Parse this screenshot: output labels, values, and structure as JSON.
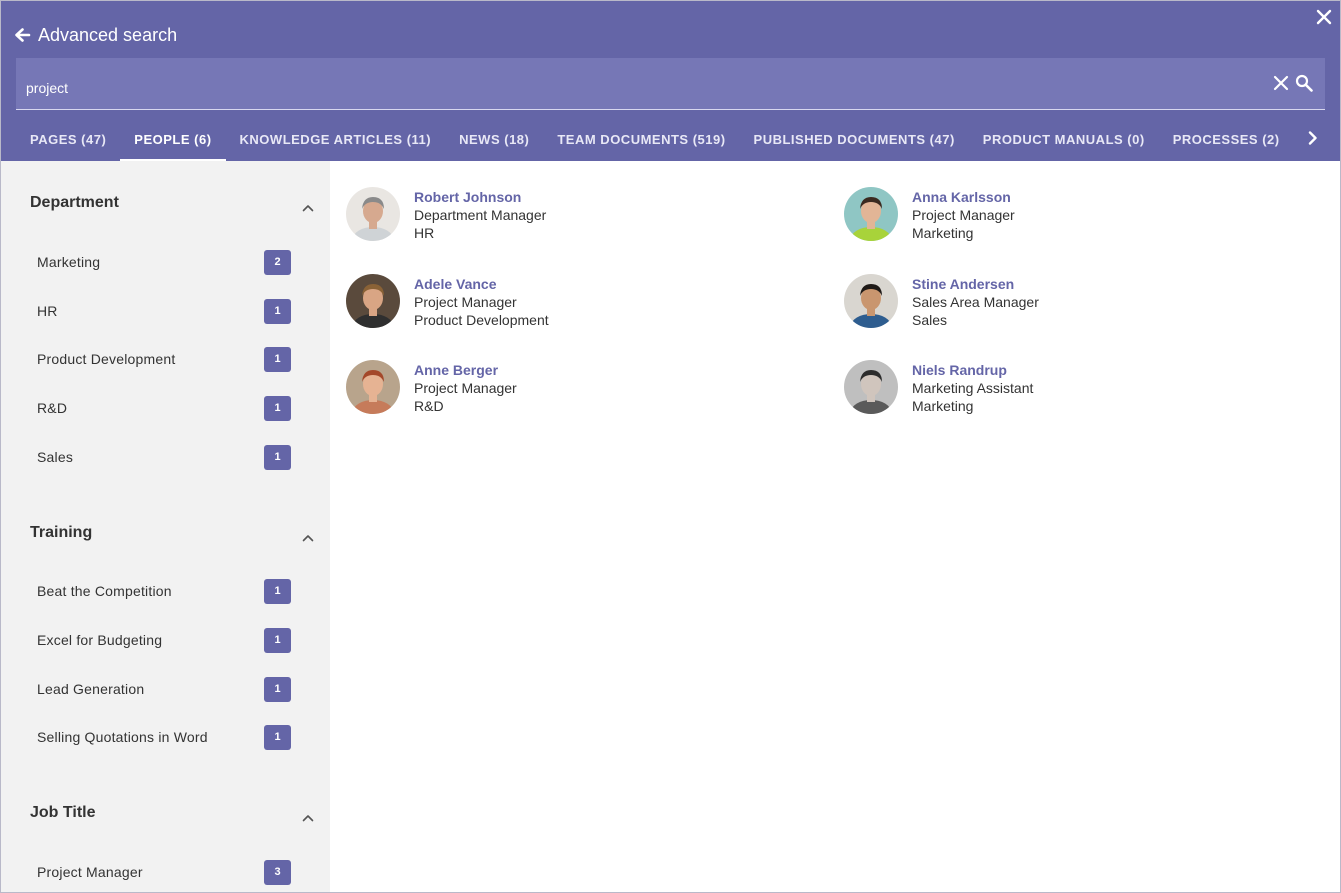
{
  "header": {
    "title": "Advanced search",
    "accent_color": "#6465a7"
  },
  "search": {
    "value": "project",
    "placeholder": ""
  },
  "tabs": [
    {
      "label": "PAGES (47)",
      "active": false
    },
    {
      "label": "PEOPLE (6)",
      "active": true
    },
    {
      "label": "KNOWLEDGE ARTICLES (11)",
      "active": false
    },
    {
      "label": "NEWS (18)",
      "active": false
    },
    {
      "label": "TEAM DOCUMENTS (519)",
      "active": false
    },
    {
      "label": "PUBLISHED DOCUMENTS (47)",
      "active": false
    },
    {
      "label": "PRODUCT MANUALS (0)",
      "active": false
    },
    {
      "label": "PROCESSES (2)",
      "active": false
    }
  ],
  "facets": [
    {
      "title": "Department",
      "items": [
        {
          "label": "Marketing",
          "count": "2"
        },
        {
          "label": "HR",
          "count": "1"
        },
        {
          "label": "Product Development",
          "count": "1"
        },
        {
          "label": "R&D",
          "count": "1"
        },
        {
          "label": "Sales",
          "count": "1"
        }
      ]
    },
    {
      "title": "Training",
      "items": [
        {
          "label": "Beat the Competition",
          "count": "1"
        },
        {
          "label": "Excel for Budgeting",
          "count": "1"
        },
        {
          "label": "Lead Generation",
          "count": "1"
        },
        {
          "label": "Selling Quotations in Word",
          "count": "1"
        }
      ]
    },
    {
      "title": "Job Title",
      "items": [
        {
          "label": "Project Manager",
          "count": "3"
        }
      ]
    }
  ],
  "people": [
    {
      "name": "Robert Johnson",
      "title": "Department Manager",
      "department": "HR"
    },
    {
      "name": "Anna Karlsson",
      "title": "Project Manager",
      "department": "Marketing"
    },
    {
      "name": "Adele Vance",
      "title": "Project Manager",
      "department": "Product Development"
    },
    {
      "name": "Stine Andersen",
      "title": "Sales Area Manager",
      "department": "Sales"
    },
    {
      "name": "Anne Berger",
      "title": "Project Manager",
      "department": "R&D"
    },
    {
      "name": "Niels Randrup",
      "title": "Marketing Assistant",
      "department": "Marketing"
    }
  ]
}
